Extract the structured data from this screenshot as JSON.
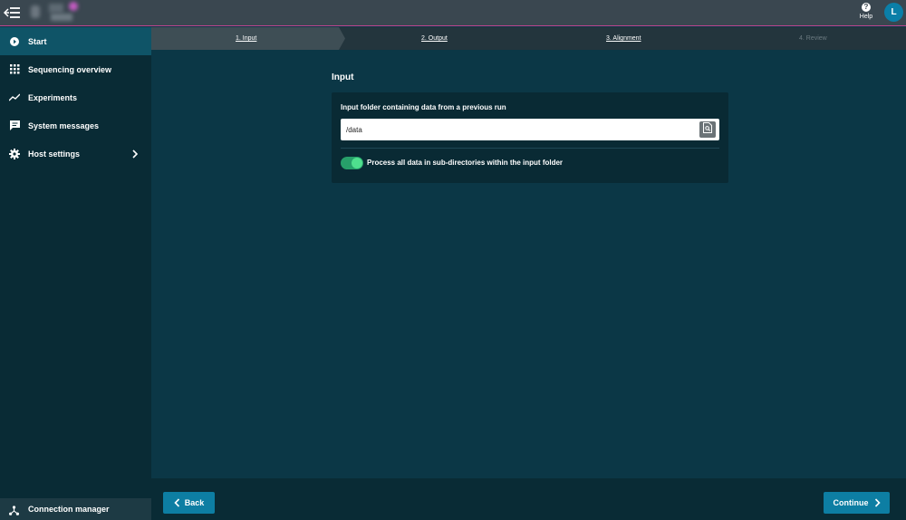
{
  "topbar": {
    "help_label": "Help",
    "avatar_initial": "L"
  },
  "sidebar": {
    "items": [
      {
        "label": "Start",
        "icon": "play-circle-icon",
        "active": true
      },
      {
        "label": "Sequencing overview",
        "icon": "grid-icon"
      },
      {
        "label": "Experiments",
        "icon": "trend-line-icon"
      },
      {
        "label": "System messages",
        "icon": "message-icon"
      },
      {
        "label": "Host settings",
        "icon": "gear-icon",
        "has_submenu": true
      }
    ],
    "connection_manager": "Connection manager"
  },
  "stepper": {
    "steps": [
      {
        "label": "1. Input",
        "state": "active"
      },
      {
        "label": "2. Output",
        "state": "enabled"
      },
      {
        "label": "3. Alignment",
        "state": "enabled"
      },
      {
        "label": "4. Review",
        "state": "disabled"
      }
    ]
  },
  "main": {
    "section_title": "Input",
    "input_folder": {
      "label": "Input folder containing data from a previous run",
      "value": "/data"
    },
    "subdir_toggle": {
      "label": "Process all data in sub-directories within the input folder",
      "checked": true
    }
  },
  "footer": {
    "back_label": "Back",
    "continue_label": "Continue"
  },
  "colors": {
    "accent": "#0d7ea3",
    "toggle_on": "#27a06a",
    "nav_active": "#0f5467",
    "brand_line": "#c0448f"
  }
}
